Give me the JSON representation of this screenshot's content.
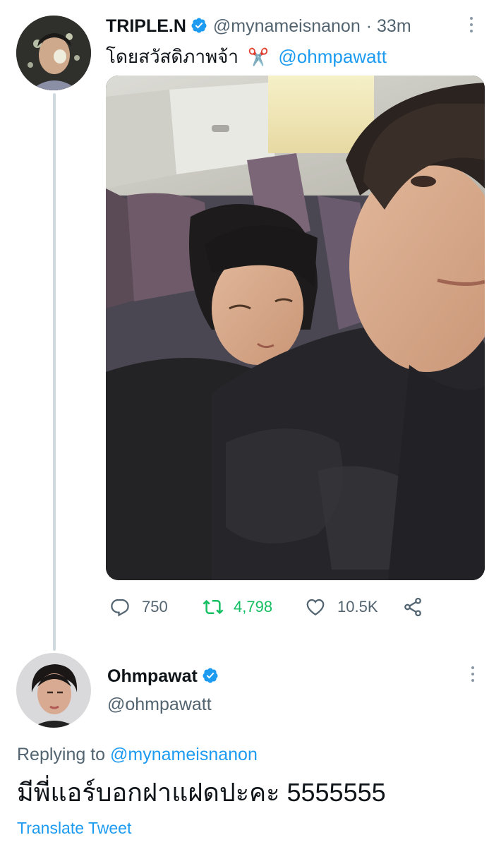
{
  "tweet": {
    "display_name": "TRIPLE.N",
    "handle": "@mynameisnanon",
    "time": "· 33m",
    "text": "โดยสวัสดิภาพจ้า",
    "emoji": "✂️",
    "mention": "@ohmpawatt",
    "stats": {
      "replies": "750",
      "retweets": "4,798",
      "likes": "10.5K"
    },
    "colors": {
      "retweet": "#17bf63",
      "link": "#1d9bf0",
      "muted": "#536471"
    }
  },
  "reply": {
    "display_name": "Ohmpawat",
    "handle": "@ohmpawatt",
    "replying_prefix": "Replying to",
    "replying_to": "@mynameisnanon",
    "text": "มีพี่แอร์บอกฝาแฝดปะคะ 5555555",
    "translate": "Translate Tweet"
  },
  "icons": [
    "verified-badge-icon",
    "more-options-icon",
    "reply-icon",
    "retweet-icon",
    "like-icon",
    "share-icon"
  ]
}
